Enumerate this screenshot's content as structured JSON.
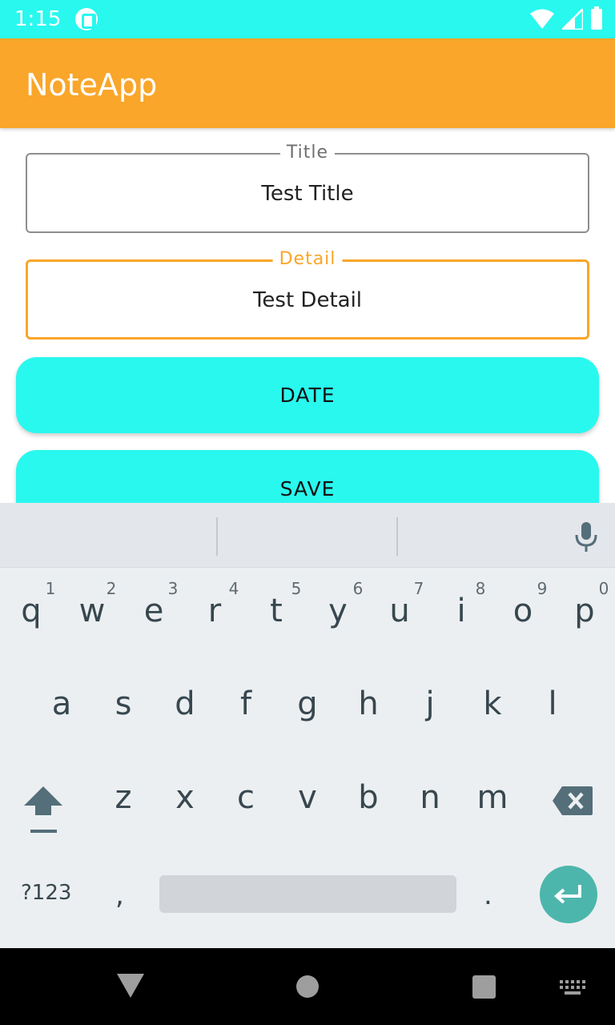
{
  "status_bar": {
    "time": "1:15"
  },
  "app_bar": {
    "title": "NoteApp"
  },
  "form": {
    "title_label": "Title",
    "title_value": "Test Title",
    "detail_label": "Detail",
    "detail_value": "Test Detail"
  },
  "buttons": {
    "date_label": "DATE",
    "save_label": "SAVE"
  },
  "keyboard": {
    "row1": [
      {
        "key": "q",
        "hint": "1"
      },
      {
        "key": "w",
        "hint": "2"
      },
      {
        "key": "e",
        "hint": "3"
      },
      {
        "key": "r",
        "hint": "4"
      },
      {
        "key": "t",
        "hint": "5"
      },
      {
        "key": "y",
        "hint": "6"
      },
      {
        "key": "u",
        "hint": "7"
      },
      {
        "key": "i",
        "hint": "8"
      },
      {
        "key": "o",
        "hint": "9"
      },
      {
        "key": "p",
        "hint": "0"
      }
    ],
    "row2": [
      "a",
      "s",
      "d",
      "f",
      "g",
      "h",
      "j",
      "k",
      "l"
    ],
    "row3": [
      "z",
      "x",
      "c",
      "v",
      "b",
      "n",
      "m"
    ],
    "symbols_label": "?123",
    "comma_label": ",",
    "period_label": "."
  },
  "colors": {
    "status_bar": "#29f8ee",
    "app_bar": "#f9a62a",
    "button": "#29f8ee",
    "focused_field": "#f9a62a",
    "enter_key": "#4db6ac"
  }
}
